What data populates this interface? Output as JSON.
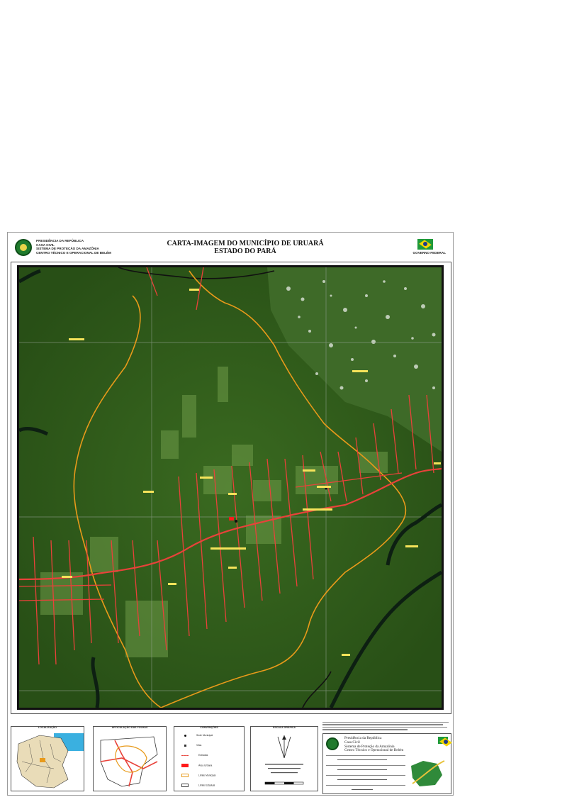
{
  "header": {
    "org_lines": [
      "PRESIDÊNCIA DA REPÚBLICA",
      "CASA CIVIL",
      "SISTEMA DE PROTEÇÃO DA AMAZÔNIA",
      "CENTRO TÉCNICO E OPERACIONAL DE BELÉM"
    ],
    "title": "CARTA-IMAGEM DO MUNICÍPIO DE URUARÁ",
    "subtitle": "ESTADO DO PARÁ",
    "gov_label": "GOVERNO FEDERAL"
  },
  "legend": {
    "location_title": "LOCALIZAÇÃO",
    "articulation_title": "ARTICULAÇÃO DAS FOLHAS",
    "conventions_title": "CONVENÇÕES",
    "conventions": [
      {
        "label": "Sede Municipal",
        "color": "#111111"
      },
      {
        "label": "Vilas",
        "color": "#333333"
      },
      {
        "label": "Estradas",
        "color": "#e8423a"
      },
      {
        "label": "Área Urbana",
        "color": "#ff1a1a"
      },
      {
        "label": "Limite Municipal",
        "color": "#e89a1a"
      },
      {
        "label": "Limite Estadual",
        "color": "#444444"
      }
    ],
    "scale_title": "ESCALA GRÁFICA"
  },
  "credits": {
    "presidency": [
      "Presidência da República",
      "Casa Civil",
      "Sistema de Proteção da Amazônia",
      "Centro Técnico e Operacional de Belém"
    ]
  },
  "colors": {
    "forest": "#2e5a1a",
    "deforest": "#5e8a3a",
    "road": "#e8423a",
    "boundary": "#e89a1a",
    "river": "#0d1f12"
  }
}
